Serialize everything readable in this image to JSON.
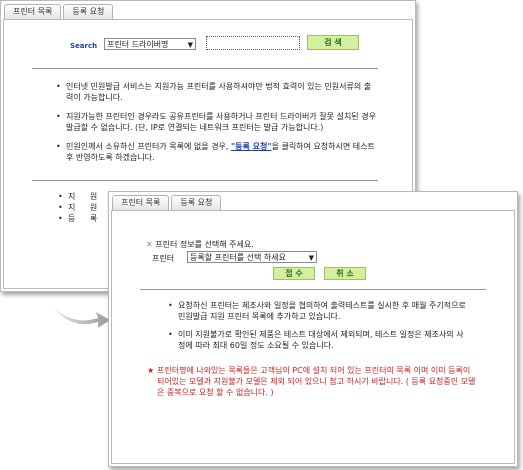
{
  "back_panel": {
    "tabs": [
      "프린터 목록",
      "등록 요청"
    ],
    "search": {
      "label": "Search",
      "select_value": "프린터 드라이버명",
      "button_label": "검 색"
    },
    "bullets": [
      "인터넷 민원발급 서비스는 지원가능 프린터를 사용하셔야만 법적 효력이 있는 민원서류의 출력이 가능합니다.",
      "지원가능한 프린터인 경우라도 공유프린터를 사용하거나 프린터 드라이버가 잘못 설치된 경우 발급할 수 없습니다. (단, IP로 연결되는 네트워크 프린터는 발급 가능합니다.)"
    ],
    "bullet3": {
      "before": "민원인께서 소유하신 프린터가 목록에 없을 경우, ",
      "link": "\"등록 요청\"",
      "after": "을 클릭하여 요청하시면 테스트 후 반영하도록 하겠습니다."
    },
    "bottom_items": [
      "지 원 가",
      "지 원 불",
      "등 록 요 청"
    ]
  },
  "front_panel": {
    "tabs": [
      "프린터 목록",
      "등록 요청"
    ],
    "prompt": "프린터 정보를 선택해 주세요.",
    "printer_label": "프린터",
    "printer_select_value": "등록할 프린터를 선택 하세요",
    "confirm_label": "접 수",
    "cancel_label": "취 소",
    "bullets": [
      "요청하신 프린터는 제조사와 일정을 협의하여 출력테스트를 실시한 후 매월 주기적으로 민원발급 지원 프린터 목록에 추가하고 있습니다.",
      "이미 지원불가로 확인된 제품은 테스트 대상에서 제외되며, 테스트 일정은 제조사의 사정에 따라 최대 60일 정도 소요될 수 있습니다."
    ],
    "notice": "프린터명에 나와있는 목록들은 고객님의 PC에 설치 되어 있는 프린터의 목록 이며 이미 등록이 되어있는 모델과 지원불가 모델은 제외 되어 있으니 참고 하시기 바랍니다. ( 등록 요청중인 모델은 중복으로 요청 할 수 없습니다. )"
  },
  "colors": {
    "button_bg": "#d4ef9e",
    "button_text": "#2c6e1d",
    "link": "#1a3fb0",
    "notice": "#cc1d1d",
    "search_label": "#1d3f8f"
  }
}
